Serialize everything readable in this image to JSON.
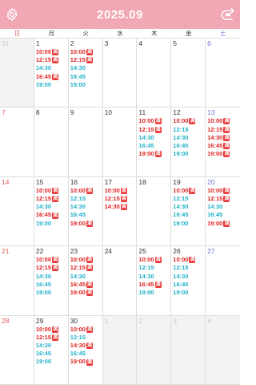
{
  "header": {
    "title": "2025.09",
    "settings_icon": "gear-icon",
    "today_icon": "today-return-icon",
    "colors": {
      "bar": "#f1a7b4",
      "text": "#ffffff"
    }
  },
  "weekdays": [
    "日",
    "月",
    "火",
    "水",
    "木",
    "金",
    "土"
  ],
  "badge_label": "満",
  "colors": {
    "full_slot": "#e02020",
    "open_slot": "#20b0c8",
    "sunday": "#e05a5a",
    "saturday": "#6f6fd8",
    "other_month_bg": "#f3f3f3"
  },
  "weeks": [
    [
      {
        "day": "31",
        "other": true,
        "slots": []
      },
      {
        "day": "1",
        "slots": [
          [
            "10:00",
            true
          ],
          [
            "12:15",
            true
          ],
          [
            "14:30",
            false
          ],
          [
            "16:45",
            true
          ],
          [
            "19:00",
            false
          ]
        ]
      },
      {
        "day": "2",
        "slots": [
          [
            "10:00",
            true
          ],
          [
            "12:15",
            true
          ],
          [
            "14:30",
            false
          ],
          [
            "16:45",
            false
          ],
          [
            "19:00",
            false
          ]
        ]
      },
      {
        "day": "3",
        "slots": []
      },
      {
        "day": "4",
        "slots": []
      },
      {
        "day": "5",
        "slots": []
      },
      {
        "day": "6",
        "slots": []
      }
    ],
    [
      {
        "day": "7",
        "slots": []
      },
      {
        "day": "8",
        "slots": []
      },
      {
        "day": "9",
        "slots": []
      },
      {
        "day": "10",
        "slots": []
      },
      {
        "day": "11",
        "slots": [
          [
            "10:00",
            true
          ],
          [
            "12:15",
            true
          ],
          [
            "14:30",
            false
          ],
          [
            "16:45",
            false
          ],
          [
            "19:00",
            true
          ]
        ]
      },
      {
        "day": "12",
        "slots": [
          [
            "10:00",
            true
          ],
          [
            "12:15",
            false
          ],
          [
            "14:30",
            false
          ],
          [
            "16:45",
            false
          ],
          [
            "19:00",
            false
          ]
        ]
      },
      {
        "day": "13",
        "slots": [
          [
            "10:00",
            true
          ],
          [
            "12:15",
            true
          ],
          [
            "14:30",
            true
          ],
          [
            "16:45",
            true
          ],
          [
            "19:00",
            true
          ]
        ]
      }
    ],
    [
      {
        "day": "14",
        "slots": []
      },
      {
        "day": "15",
        "slots": [
          [
            "10:00",
            true
          ],
          [
            "12:15",
            true
          ],
          [
            "14:30",
            false
          ],
          [
            "16:45",
            true
          ],
          [
            "19:00",
            false
          ]
        ]
      },
      {
        "day": "16",
        "slots": [
          [
            "10:00",
            true
          ],
          [
            "12:15",
            false
          ],
          [
            "14:30",
            false
          ],
          [
            "16:45",
            false
          ],
          [
            "19:00",
            true
          ]
        ]
      },
      {
        "day": "17",
        "slots": [
          [
            "10:00",
            true
          ],
          [
            "12:15",
            true
          ],
          [
            "14:30",
            true
          ]
        ]
      },
      {
        "day": "18",
        "slots": []
      },
      {
        "day": "19",
        "slots": [
          [
            "10:00",
            true
          ],
          [
            "12:15",
            false
          ],
          [
            "14:30",
            false
          ],
          [
            "16:45",
            false
          ],
          [
            "19:00",
            false
          ]
        ]
      },
      {
        "day": "20",
        "slots": [
          [
            "10:00",
            true
          ],
          [
            "12:15",
            true
          ],
          [
            "14:30",
            false
          ],
          [
            "16:45",
            false
          ],
          [
            "19:00",
            true
          ]
        ]
      }
    ],
    [
      {
        "day": "21",
        "slots": []
      },
      {
        "day": "22",
        "slots": [
          [
            "10:00",
            true
          ],
          [
            "12:15",
            true
          ],
          [
            "14:30",
            false
          ],
          [
            "16:45",
            false
          ],
          [
            "19:00",
            false
          ]
        ]
      },
      {
        "day": "23",
        "slots": [
          [
            "10:00",
            true
          ],
          [
            "12:15",
            true
          ],
          [
            "14:30",
            false
          ],
          [
            "16:45",
            true
          ],
          [
            "19:00",
            true
          ]
        ]
      },
      {
        "day": "24",
        "slots": []
      },
      {
        "day": "25",
        "slots": [
          [
            "10:00",
            true
          ],
          [
            "12:15",
            false
          ],
          [
            "14:30",
            false
          ],
          [
            "16:45",
            true
          ],
          [
            "19:00",
            false
          ]
        ]
      },
      {
        "day": "26",
        "slots": [
          [
            "10:00",
            true
          ],
          [
            "12:15",
            false
          ],
          [
            "14:30",
            false
          ],
          [
            "16:45",
            false
          ],
          [
            "19:00",
            false
          ]
        ]
      },
      {
        "day": "27",
        "slots": []
      }
    ],
    [
      {
        "day": "28",
        "slots": []
      },
      {
        "day": "29",
        "slots": [
          [
            "10:00",
            true
          ],
          [
            "12:15",
            true
          ],
          [
            "14:30",
            false
          ],
          [
            "16:45",
            false
          ],
          [
            "19:00",
            false
          ]
        ]
      },
      {
        "day": "30",
        "slots": [
          [
            "10:00",
            true
          ],
          [
            "12:15",
            false
          ],
          [
            "14:30",
            true
          ],
          [
            "16:45",
            false
          ],
          [
            "19:00",
            true
          ]
        ]
      },
      {
        "day": "1",
        "other": true,
        "slots": []
      },
      {
        "day": "2",
        "other": true,
        "slots": []
      },
      {
        "day": "3",
        "other": true,
        "slots": []
      },
      {
        "day": "4",
        "other": true,
        "slots": []
      }
    ]
  ]
}
